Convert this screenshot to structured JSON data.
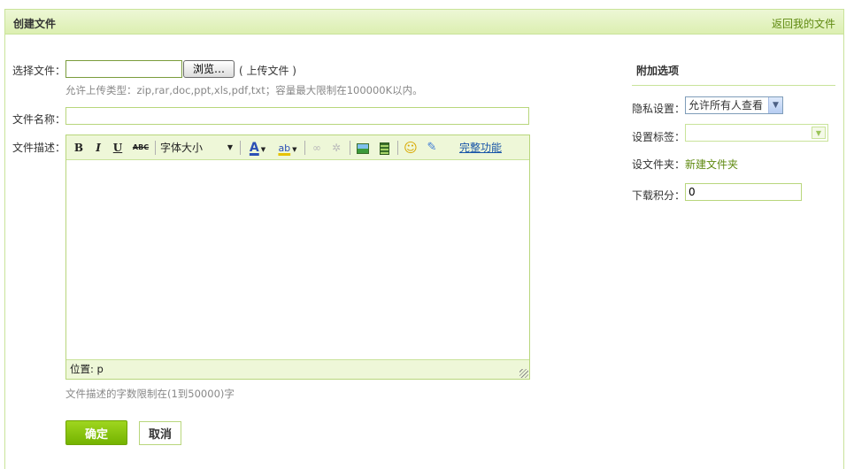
{
  "header": {
    "title": "创建文件",
    "back_link": "返回我的文件"
  },
  "form": {
    "select_file_label": "选择文件：",
    "browse_button": "浏览…",
    "upload_note": "( 上传文件 )",
    "allowed_types_hint": "允许上传类型：zip,rar,doc,ppt,xls,pdf,txt；容量最大限制在100000K以内。",
    "file_name_label": "文件名称：",
    "file_name_value": "",
    "description_label": "文件描述：",
    "description_hint": "文件描述的字数限制在(1到50000)字",
    "ok_button": "确定",
    "cancel_button": "取消"
  },
  "editor": {
    "bold": "B",
    "italic": "I",
    "underline": "U",
    "strike": "ABC",
    "font_size": "字体大小",
    "font_color": "A",
    "highlight": "ab",
    "full_features": "完整功能",
    "status": "位置: p",
    "colors": {
      "font_color_bar": "#2b4fb5",
      "highlight_bar": "#e6c200"
    }
  },
  "sidebar": {
    "title": "附加选项",
    "privacy_label": "隐私设置：",
    "privacy_value": "允许所有人查看",
    "tags_label": "设置标签：",
    "tags_value": "",
    "folder_label": "设文件夹：",
    "folder_link": "新建文件夹",
    "points_label": "下载积分：",
    "points_value": "0"
  },
  "theme": {
    "accent": "#74b300",
    "border": "#c9e39a",
    "link": "#5f8a10"
  }
}
